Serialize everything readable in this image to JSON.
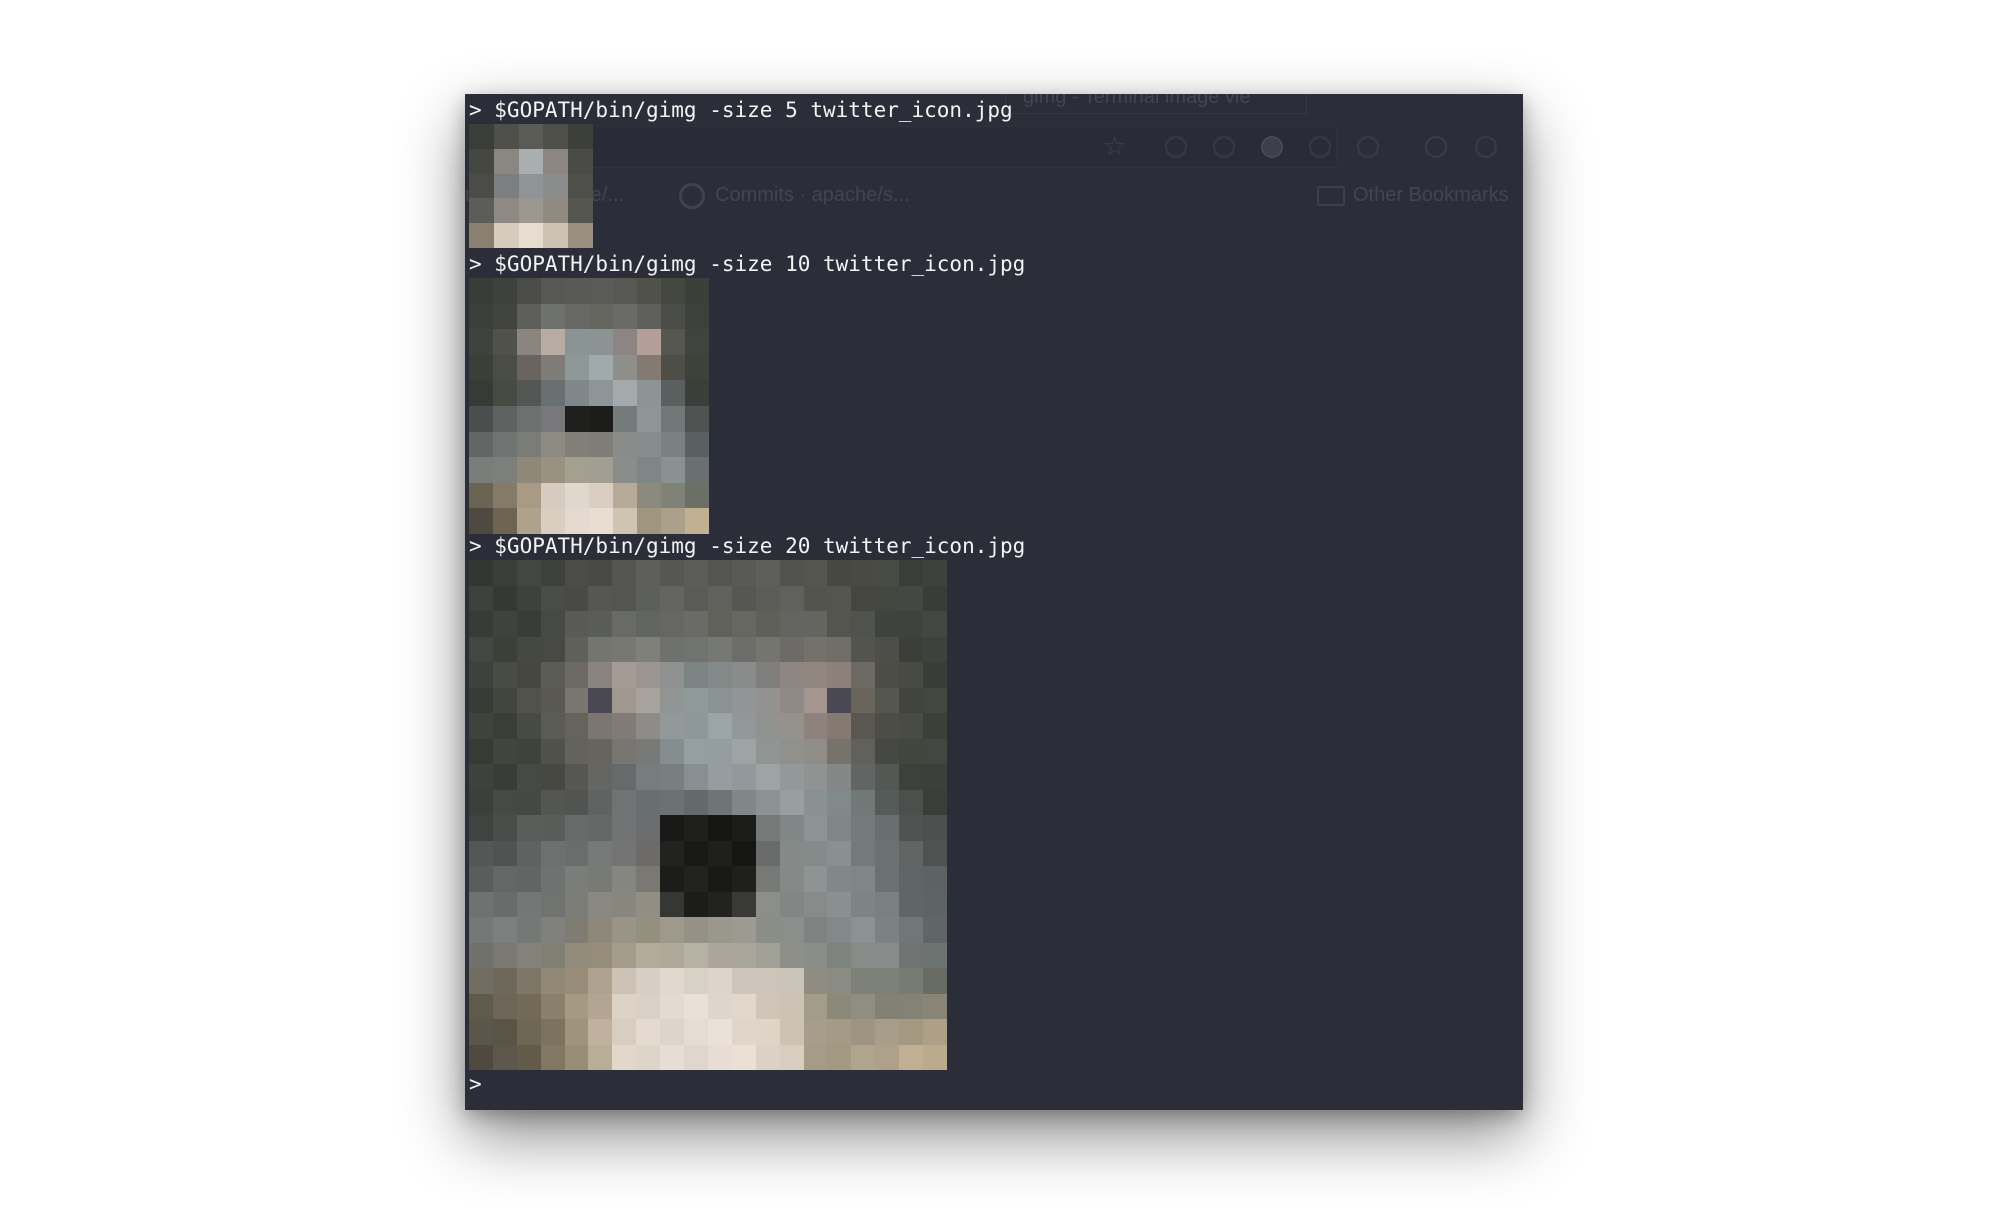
{
  "ghost_browser": {
    "tab_title": "gimg - Terminal image vie",
    "bookmark_1": "mmits · apache/...",
    "bookmark_2": "Commits · apache/s...",
    "bookmark_3": "Other Bookmarks"
  },
  "terminal": {
    "prompt_symbol": ">",
    "commands": [
      {
        "text": "> $GOPATH/bin/gimg -size 5 twitter_icon.jpg",
        "size": 5
      },
      {
        "text": "> $GOPATH/bin/gimg -size 10 twitter_icon.jpg",
        "size": 10
      },
      {
        "text": "> $GOPATH/bin/gimg -size 20 twitter_icon.jpg",
        "size": 20
      }
    ],
    "final_prompt": ">"
  },
  "images": {
    "size5": [
      [
        "#3b3d38",
        "#4f504b",
        "#5a5b55",
        "#4f504a",
        "#3d3f3a"
      ],
      [
        "#454741",
        "#8a8782",
        "#a9aeae",
        "#8b8680",
        "#4a4b46"
      ],
      [
        "#4b4c47",
        "#7c7f7f",
        "#8f9596",
        "#8a8d8c",
        "#4e4f4a"
      ],
      [
        "#5c5d58",
        "#8e8a83",
        "#9c9890",
        "#908a80",
        "#55564f"
      ],
      [
        "#8a7f70",
        "#d6cbbd",
        "#e6dcd0",
        "#cdc2b4",
        "#9a8f80"
      ]
    ],
    "size10": [
      [
        "#3a3c37",
        "#3f413c",
        "#4b4c47",
        "#575853",
        "#595a55",
        "#5a5b56",
        "#575853",
        "#505149",
        "#454741",
        "#3c3e39"
      ],
      [
        "#3d3f3a",
        "#41433e",
        "#5e5f5a",
        "#6f716c",
        "#686964",
        "#65665f",
        "#6a6b66",
        "#5f605b",
        "#4a4c47",
        "#3e403b"
      ],
      [
        "#40423d",
        "#505149",
        "#8b8580",
        "#b8aba4",
        "#8a9495",
        "#8d9395",
        "#8c8584",
        "#b49f98",
        "#56574f",
        "#41433e"
      ],
      [
        "#3c3e38",
        "#4a4c46",
        "#6a645e",
        "#7f7c78",
        "#8e9899",
        "#a0a9ab",
        "#8e8f8b",
        "#857a72",
        "#4c4e47",
        "#3f413b"
      ],
      [
        "#383a35",
        "#474943",
        "#555754",
        "#6a7072",
        "#7f878a",
        "#8d9598",
        "#a2aaab",
        "#8d9495",
        "#5a605f",
        "#3c3e39"
      ],
      [
        "#4a4e4c",
        "#5e6260",
        "#6c7170",
        "#78787a",
        "#1f1f1e",
        "#1c1c1b",
        "#757a7a",
        "#8e9595",
        "#707878",
        "#4e5251"
      ],
      [
        "#626766",
        "#6f7473",
        "#7a7c78",
        "#8d8a82",
        "#827f78",
        "#7f7d78",
        "#8a8c89",
        "#878d8d",
        "#7a8181",
        "#596060"
      ],
      [
        "#7a7e7b",
        "#7c7f7a",
        "#8f8878",
        "#9a9280",
        "#a4a090",
        "#a39e92",
        "#8a8e8a",
        "#7f8686",
        "#8b9191",
        "#69706f"
      ],
      [
        "#6a6353",
        "#857a66",
        "#a99a83",
        "#d5cbc0",
        "#e1d8cd",
        "#d9cec1",
        "#b7ab98",
        "#8c8a7c",
        "#808278",
        "#6c6f66"
      ],
      [
        "#4e4a3f",
        "#6d6452",
        "#b0a28a",
        "#d9cec0",
        "#e4dad0",
        "#e8ddd0",
        "#cfc3b1",
        "#9f967f",
        "#ada08a",
        "#c2b092"
      ]
    ]
  }
}
